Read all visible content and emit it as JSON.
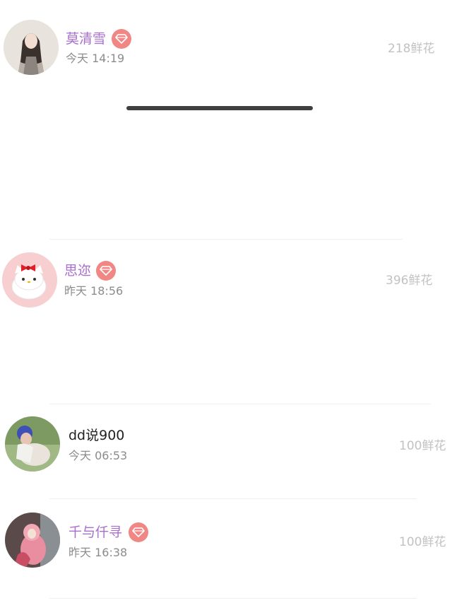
{
  "list": {
    "items": [
      {
        "name": "莫清雪",
        "time": "今天 14:19",
        "flowers": "218鲜花",
        "vip": true
      },
      {
        "name": "思迩",
        "time": "昨天 18:56",
        "flowers": "396鲜花",
        "vip": true
      },
      {
        "name": "dd说900",
        "time": "今天 06:53",
        "flowers": "100鲜花",
        "vip": false
      },
      {
        "name": "千与仟寻",
        "time": "昨天 16:38",
        "flowers": "100鲜花",
        "vip": true
      }
    ]
  },
  "colors": {
    "vip_name": "#a86fd0",
    "badge": "#f08784",
    "time": "#8c8c8c",
    "flowers": "#c2c2c2"
  },
  "icons": {
    "badge": "diamond-icon"
  }
}
